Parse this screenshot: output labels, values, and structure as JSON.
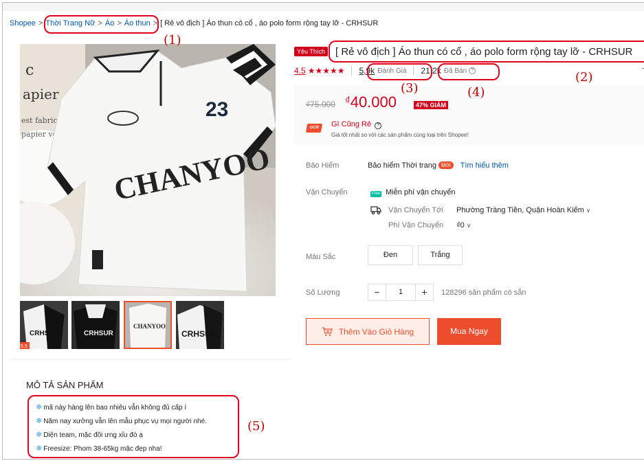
{
  "breadcrumb": {
    "items": [
      "Shopee",
      "Thời Trang Nữ",
      "Áo",
      "Áo thun"
    ],
    "current": "[ Rẻ vô địch ] Áo thun có cổ , áo polo form rộng tay lỡ - CRHSUR",
    "separator": ">"
  },
  "annotations": [
    "(1)",
    "(2)",
    "(3)",
    "(4)",
    "(5)"
  ],
  "product": {
    "badge": "Yêu Thích",
    "title": "[ Rẻ vô địch ] Áo thun có cổ , áo polo form rộng tay lỡ - CRHSUR",
    "rating": "4.5",
    "stars": "★★★★★",
    "rating_fraction": 0.9,
    "reviews_count": "5,9k",
    "reviews_label": "Đánh Giá",
    "sold_count": "21,2k",
    "sold_label": "Đã Bán",
    "help": "?"
  },
  "price": {
    "original": "₫75.000",
    "currency": "₫",
    "current": "40.000",
    "discount": "47% GIẢM",
    "promo_logo": "GCR",
    "promo_title": "Gì Cũng Rẻ",
    "promo_subtitle": "Giá tốt nhất so với các sản phẩm cùng loại trên Shopee!"
  },
  "insurance": {
    "label": "Bảo Hiểm",
    "value": "Bảo hiểm Thời trang",
    "badge": "Mới",
    "link": "Tìm hiểu thêm"
  },
  "shipping": {
    "label": "Vận Chuyển",
    "free_badge": "Free",
    "free_text": "Miễn phí vận chuyển",
    "to_label": "Vận Chuyển Tới",
    "to_value": "Phường Tràng Tiền, Quận Hoàn Kiếm",
    "fee_label": "Phí Vận Chuyển",
    "fee_value": "₫0",
    "chevron": "∨"
  },
  "color": {
    "label": "Màu Sắc",
    "options": [
      "Đen",
      "Trắng"
    ]
  },
  "quantity": {
    "label": "Số Lượng",
    "minus": "−",
    "value": "1",
    "plus": "+",
    "stock": "128296 sản phẩm có sẵn"
  },
  "actions": {
    "add_to_cart": "Thêm Vào Giỏ Hàng",
    "buy_now": "Mua Ngay"
  },
  "description": {
    "heading": "MÔ TẢ SẢN PHẨM",
    "bullet": "❄",
    "lines": [
      "mã này hàng lên bao nhiêu vẫn không đủ cấp í",
      "Năm nay xưởng vẫn lên mẫu phục vụ mọi người nhé.",
      "Diện team, mặc đôi ưng xỉu đó ạ",
      "Freesize: Phom 38-65kg mặc đẹp nha!"
    ]
  },
  "image_text": {
    "number": "23",
    "brand": "CHANYOO",
    "thumb_brand": "CRHSUR",
    "thumb_badge": "5.5",
    "bg_text": [
      "c",
      "apier",
      "est fabriqué",
      "papier végéta"
    ]
  },
  "colors": {
    "accent": "#ee4d2d",
    "price_red": "#d0011b",
    "link_blue": "#0055aa",
    "annotation_red": "#e3001b"
  }
}
